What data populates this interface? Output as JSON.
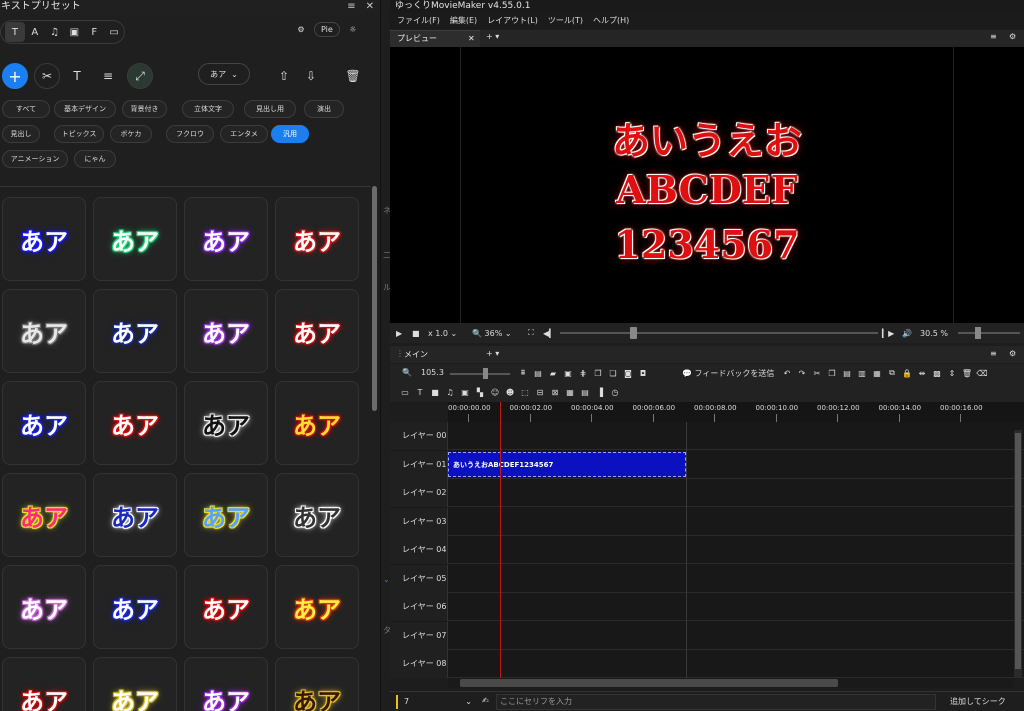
{
  "left_panel": {
    "title": "キストプリセット",
    "window_controls": [
      "≡",
      "✕"
    ],
    "type_tabs": [
      "T",
      "A",
      "♫",
      "▣",
      "F",
      "▭"
    ],
    "pie_label": "Pie",
    "font_selector": "あア",
    "categories": [
      "すべて",
      "基本デザイン",
      "背景付き",
      "立体文字",
      "見出し用",
      "演出",
      "見出し",
      "トピックス",
      "ボケカ",
      "フクロウ",
      "エンタメ",
      "汎用",
      "アニメーション",
      "にゃん"
    ],
    "selected_category": "汎用",
    "preset_sample": "あア",
    "preset_styles": [
      {
        "fill": "#ffffff",
        "glow": "#1a1aff"
      },
      {
        "fill": "#ffffff",
        "glow": "#27d37a"
      },
      {
        "fill": "#ffffff",
        "glow": "#8a2be2"
      },
      {
        "fill": "#ffffff",
        "glow": "#d01818"
      },
      {
        "fill": "#e8e8e8",
        "glow": "#777777"
      },
      {
        "fill": "#ffffff",
        "glow": "#1a2a9c"
      },
      {
        "fill": "#ffffff",
        "glow": "#9a3ad8"
      },
      {
        "fill": "#ffffff",
        "glow": "#c01010"
      },
      {
        "fill": "#ffffff",
        "glow": "#1a22d8"
      },
      {
        "fill": "#ffffff",
        "glow": "#d01010"
      },
      {
        "fill": "#111111",
        "glow": "#eeeeee"
      },
      {
        "fill": "#ffdd33",
        "glow": "#c01010"
      },
      {
        "fill": "#ff2a7a",
        "glow": "#e8e030"
      },
      {
        "fill": "#1a2ac0",
        "glow": "#ffffff"
      },
      {
        "fill": "#5aa0ff",
        "glow": "#e8e030"
      },
      {
        "fill": "#333333",
        "glow": "#ffffff"
      },
      {
        "fill": "#ffffff",
        "glow": "#c86ad8"
      },
      {
        "fill": "#ffffff",
        "glow": "#1a2ad8"
      },
      {
        "fill": "#ffffff",
        "glow": "#d01010"
      },
      {
        "fill": "#ffee44",
        "glow": "#d83a10"
      },
      {
        "fill": "#ffffff",
        "glow": "#c01010"
      },
      {
        "fill": "#ffffff",
        "glow": "#d8c030"
      },
      {
        "fill": "#ffffff",
        "glow": "#9a2ad8"
      },
      {
        "fill": "#331a00",
        "glow": "#e8c030"
      }
    ]
  },
  "side_ghost": [
    "ネ",
    "二",
    "ル",
    "タ"
  ],
  "app": {
    "title": "ゆっくりMovieMaker v4.55.0.1",
    "menu": [
      "ファイル(F)",
      "編集(E)",
      "レイアウト(L)",
      "ツール(T)",
      "ヘルプ(H)"
    ]
  },
  "preview": {
    "tab_label": "プレビュー",
    "lines": [
      "あいうえお",
      "ABCDEF",
      "1234567"
    ],
    "text_color": "#e01010",
    "speed": "x 1.0",
    "zoom": "36%",
    "volume": "30.5 %"
  },
  "timeline": {
    "tab_label": "メイン",
    "zoom_value": "105.3",
    "feedback_label": "フィードバックを送信",
    "ruler": [
      "00:00:00.00",
      "00:00:02.00",
      "00:00:04.00",
      "00:00:06.00",
      "00:00:08.00",
      "00:00:10.00",
      "00:00:12.00",
      "00:00:14.00",
      "00:00:16.00"
    ],
    "layers": [
      "レイヤー 00",
      "レイヤー 01",
      "レイヤー 02",
      "レイヤー 03",
      "レイヤー 04",
      "レイヤー 05",
      "レイヤー 06",
      "レイヤー 07",
      "レイヤー 08"
    ],
    "clip_text": "あいうえおABCDEF1234567"
  },
  "bottom": {
    "layer_number": "7",
    "dialogue_placeholder": "ここにセリフを入力",
    "add_seek_label": "追加してシーク"
  }
}
